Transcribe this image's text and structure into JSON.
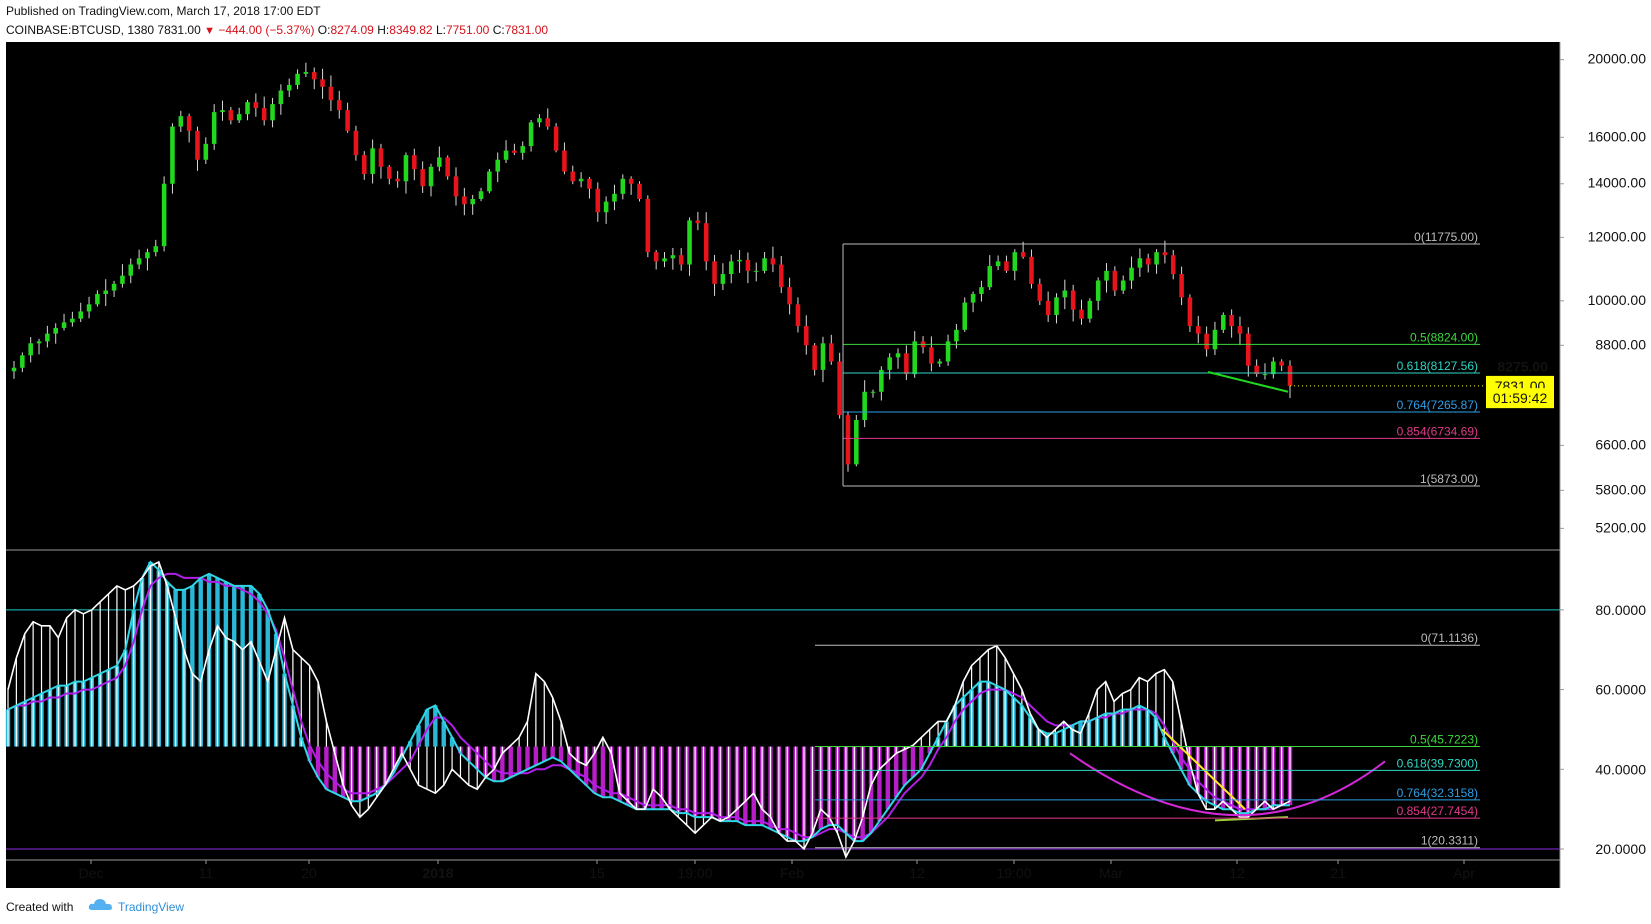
{
  "header": {
    "published": "Published on TradingView.com, March 17, 2018 17:00 EDT",
    "symbol": "COINBASE:BTCUSD, 1380",
    "last": "7831.00",
    "change": "−444.00 (−5.37%)",
    "open_label": "O:",
    "open": "8274.09",
    "high_label": "H:",
    "high": "8349.82",
    "low_label": "L:",
    "low": "7751.00",
    "close_label": "C:",
    "close": "7831.00"
  },
  "footer": {
    "created": "Created with",
    "brand": "TradingView"
  },
  "colors": {
    "up": "#22d81e",
    "down": "#e8141c",
    "cyan": "#2ed6e6",
    "purple": "#b01ee8",
    "magenta": "#d228d8",
    "white": "#ffffff"
  },
  "chart_data": [
    {
      "type": "candlestick",
      "title": "",
      "y_scale": "log",
      "ylim": [
        5000,
        20800
      ],
      "y_ticks": [
        5200,
        5800,
        6600,
        8800,
        10000,
        12000,
        14000,
        16000,
        20000
      ],
      "y_tick_labels": [
        "5200.00",
        "5800.00",
        "6600.00",
        "8800.00",
        "10000.00",
        "12000.00",
        "14000.00",
        "16000.00",
        "20000.00"
      ],
      "x_tick_labels": [
        "Dec",
        "11",
        "20",
        "2018",
        "15",
        "19:00",
        "Feb",
        "12",
        "19:00",
        "Mar",
        "12",
        "21",
        "Apr"
      ],
      "price_markers": [
        {
          "label": "8275.00",
          "value": 8275
        },
        {
          "label": "7831.00",
          "value": 7831
        },
        {
          "label": "01:59:42",
          "value": 7560
        }
      ],
      "fib_levels": [
        {
          "label": "0(11775.00)",
          "value": 11775
        },
        {
          "label": "0.5(8824.00)",
          "value": 8824
        },
        {
          "label": "0.618(8127.56)",
          "value": 8127.56
        },
        {
          "label": "0.764(7265.87)",
          "value": 7265.87
        },
        {
          "label": "0.854(6734.69)",
          "value": 6734.69
        },
        {
          "label": "1(5873.00)",
          "value": 5873
        }
      ],
      "closes": [
        8250,
        8550,
        8850,
        8900,
        9100,
        9250,
        9400,
        9500,
        9700,
        9900,
        10200,
        10300,
        10500,
        10750,
        11100,
        11300,
        11500,
        11700,
        14000,
        16500,
        17000,
        16300,
        15000,
        15700,
        17200,
        17300,
        16800,
        17100,
        17700,
        17400,
        16800,
        17600,
        18300,
        18600,
        19200,
        19300,
        18900,
        18500,
        17800,
        17300,
        16300,
        15200,
        14400,
        15500,
        14700,
        14200,
        14100,
        15200,
        14600,
        13900,
        14700,
        15100,
        14300,
        13500,
        13200,
        13400,
        13700,
        14500,
        15000,
        15400,
        15300,
        15600,
        16700,
        16900,
        16500,
        15400,
        14500,
        14100,
        14200,
        13800,
        12900,
        13300,
        13600,
        14200,
        14000,
        13400,
        11500,
        11200,
        11300,
        11400,
        11100,
        12600,
        12500,
        11200,
        10500,
        10800,
        11200,
        11250,
        10900,
        10900,
        11300,
        11100,
        10400,
        9900,
        9300,
        8800,
        8200,
        8850,
        8400,
        7200,
        6250,
        7100,
        7700,
        7700,
        8200,
        8500,
        8600,
        8100,
        8900,
        8750,
        8350,
        8400,
        8900,
        9200,
        9950,
        10200,
        10400,
        11050,
        11200,
        10900,
        11500,
        11350,
        10500,
        10000,
        9600,
        10100,
        10300,
        9750,
        9500,
        10000,
        10600,
        10900,
        10300,
        10600,
        11000,
        11300,
        11100,
        11500,
        11400,
        10800,
        10100,
        9300,
        9100,
        8700,
        9200,
        9600,
        9300,
        9100,
        8300,
        8100,
        8100,
        8400,
        8300,
        7831
      ]
    },
    {
      "type": "line",
      "title": "",
      "ylim": [
        18,
        94
      ],
      "y_ticks": [
        20,
        40,
        60,
        80
      ],
      "y_tick_labels": [
        "20.0000",
        "40.0000",
        "60.0000",
        "80.0000"
      ],
      "reference_levels": [
        80,
        20
      ],
      "fib_levels": [
        {
          "label": "0(71.1136)",
          "value": 71.1136
        },
        {
          "label": "0.5(45.7223)",
          "value": 45.7223
        },
        {
          "label": "0.618(39.7300)",
          "value": 39.73
        },
        {
          "label": "0.764(32.3158)",
          "value": 32.3158
        },
        {
          "label": "0.854(27.7454)",
          "value": 27.7454
        },
        {
          "label": "1(20.3311)",
          "value": 20.3311
        }
      ],
      "series": [
        {
          "values": [
            60,
            68,
            74,
            77,
            76,
            76,
            73,
            78,
            80,
            79,
            80,
            82,
            84,
            86,
            85,
            86,
            88,
            91,
            92,
            86,
            78,
            70,
            64,
            62,
            70,
            76,
            73,
            72,
            70,
            72,
            67,
            62,
            70,
            78,
            70,
            68,
            66,
            62,
            52,
            44,
            36,
            31,
            28,
            30,
            33,
            36,
            40,
            44,
            40,
            36,
            35,
            34,
            36,
            40,
            38,
            36,
            35,
            38,
            40,
            44,
            46,
            48,
            52,
            64,
            62,
            58,
            52,
            44,
            42,
            41,
            44,
            48,
            44,
            34,
            32,
            30,
            30,
            35,
            33,
            30,
            28,
            26,
            24,
            26,
            28,
            27,
            28,
            30,
            32,
            34,
            30,
            28,
            24,
            22,
            22,
            20,
            24,
            30,
            28,
            24,
            18,
            22,
            28,
            36,
            40,
            42,
            44,
            45,
            46,
            48,
            50,
            52,
            52,
            56,
            62,
            66,
            68,
            70,
            71,
            68,
            64,
            60,
            54,
            50,
            48,
            50,
            52,
            50,
            49,
            54,
            60,
            62,
            57,
            59,
            60,
            63,
            62,
            64,
            65,
            62,
            52,
            42,
            34,
            30,
            30,
            32,
            30,
            28,
            28,
            30,
            32,
            30,
            31,
            32
          ]
        },
        {
          "values": [
            55,
            56,
            57,
            58,
            59,
            60,
            61,
            61,
            62,
            62,
            63,
            64,
            65,
            66,
            70,
            80,
            88,
            92,
            90,
            87,
            85,
            85,
            86,
            88,
            89,
            88,
            87,
            86,
            86,
            86,
            84,
            80,
            74,
            64,
            56,
            48,
            42,
            38,
            35,
            34,
            33,
            32,
            32,
            33,
            34,
            36,
            39,
            43,
            47,
            51,
            55,
            56,
            52,
            48,
            44,
            42,
            40,
            38,
            37,
            37,
            38,
            39,
            40,
            41,
            42,
            43,
            42,
            40,
            38,
            36,
            34,
            33,
            33,
            32,
            31,
            30,
            30,
            30,
            30,
            30,
            29,
            29,
            28,
            28,
            28,
            27,
            27,
            27,
            26,
            26,
            26,
            25,
            24,
            23,
            22,
            22,
            23,
            25,
            26,
            26,
            24,
            22,
            22,
            24,
            27,
            30,
            33,
            36,
            38,
            40,
            44,
            48,
            52,
            56,
            58,
            60,
            62,
            62,
            61,
            60,
            58,
            56,
            53,
            50,
            49,
            49,
            50,
            51,
            52,
            52,
            53,
            54,
            54,
            55,
            55,
            56,
            55,
            53,
            48,
            44,
            40,
            36,
            34,
            32,
            31,
            30,
            30,
            29,
            29,
            30,
            30,
            31,
            31,
            31
          ]
        },
        {
          "values": [
            55,
            56,
            56,
            57,
            57,
            58,
            58,
            59,
            59,
            60,
            60,
            61,
            62,
            63,
            66,
            72,
            80,
            86,
            88,
            89,
            89,
            88,
            88,
            88,
            87,
            87,
            86,
            86,
            85,
            84,
            82,
            79,
            75,
            68,
            60,
            52,
            46,
            42,
            39,
            37,
            35,
            34,
            34,
            34,
            35,
            36,
            38,
            40,
            42,
            46,
            50,
            53,
            53,
            51,
            48,
            46,
            44,
            42,
            40,
            39,
            39,
            39,
            39,
            40,
            40,
            41,
            41,
            40,
            39,
            38,
            36,
            35,
            34,
            34,
            33,
            32,
            31,
            31,
            31,
            31,
            30,
            30,
            29,
            29,
            29,
            28,
            28,
            28,
            27,
            27,
            27,
            26,
            25,
            25,
            24,
            23,
            23,
            24,
            25,
            25,
            24,
            23,
            23,
            24,
            26,
            28,
            31,
            34,
            36,
            38,
            41,
            45,
            48,
            52,
            55,
            57,
            59,
            60,
            60,
            60,
            59,
            58,
            56,
            54,
            52,
            51,
            51,
            51,
            52,
            52,
            53,
            53,
            54,
            54,
            55,
            55,
            55,
            54,
            51,
            47,
            43,
            40,
            37,
            35,
            33,
            32,
            31,
            30,
            30,
            30,
            30,
            30,
            31,
            31
          ]
        }
      ]
    }
  ]
}
